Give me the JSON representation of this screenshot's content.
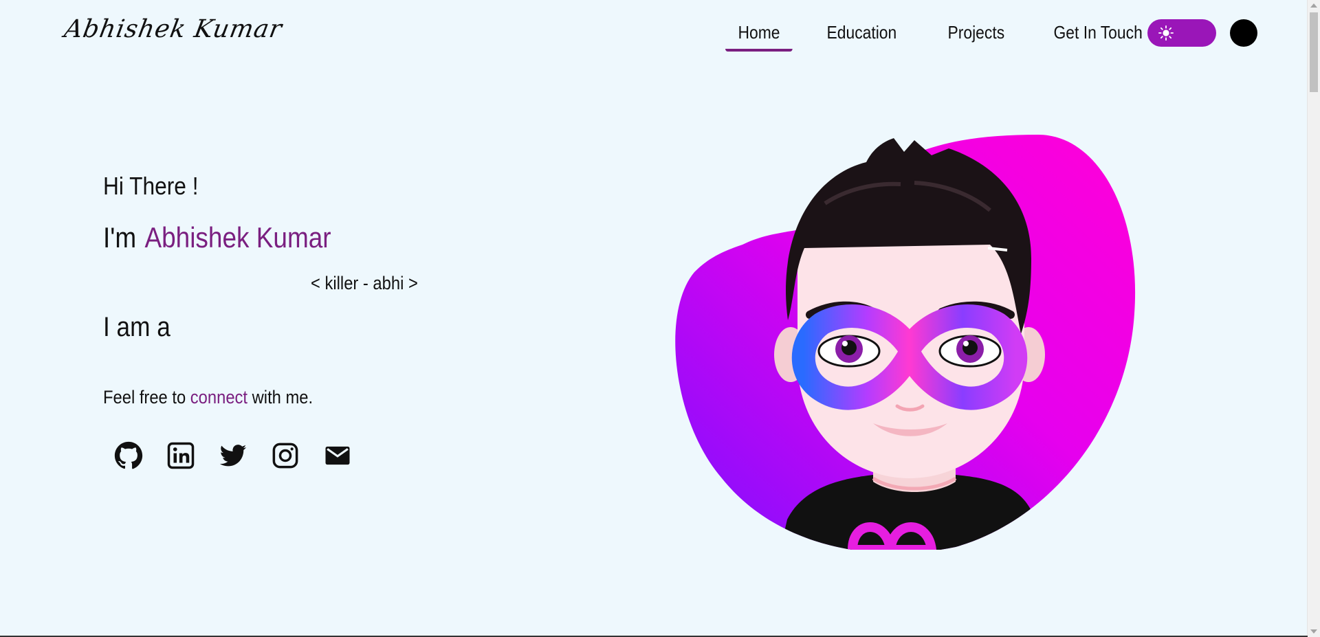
{
  "header": {
    "logo": "Abhishek Kumar",
    "nav": [
      {
        "label": "Home",
        "active": true
      },
      {
        "label": "Education",
        "active": false
      },
      {
        "label": "Projects",
        "active": false
      },
      {
        "label": "Get In Touch",
        "active": false
      }
    ],
    "theme_toggle_icon": "sun-icon",
    "accent_color": "#7a1f80",
    "toggle_color": "#9a16b8"
  },
  "hero": {
    "greeting": "Hi There !",
    "intro_prefix": "I'm",
    "name": "Abhishek Kumar",
    "alias": "< killer - abhi >",
    "role_prefix": "I am a",
    "connect_prefix": "Feel free to",
    "connect_word": "connect",
    "connect_suffix": "with me."
  },
  "socials": [
    {
      "icon": "github-icon"
    },
    {
      "icon": "linkedin-icon"
    },
    {
      "icon": "twitter-icon"
    },
    {
      "icon": "instagram-icon"
    },
    {
      "icon": "mail-icon"
    }
  ],
  "colors": {
    "background": "#eef8fd",
    "blob_start": "#ff00e6",
    "blob_end": "#8a18ff"
  }
}
